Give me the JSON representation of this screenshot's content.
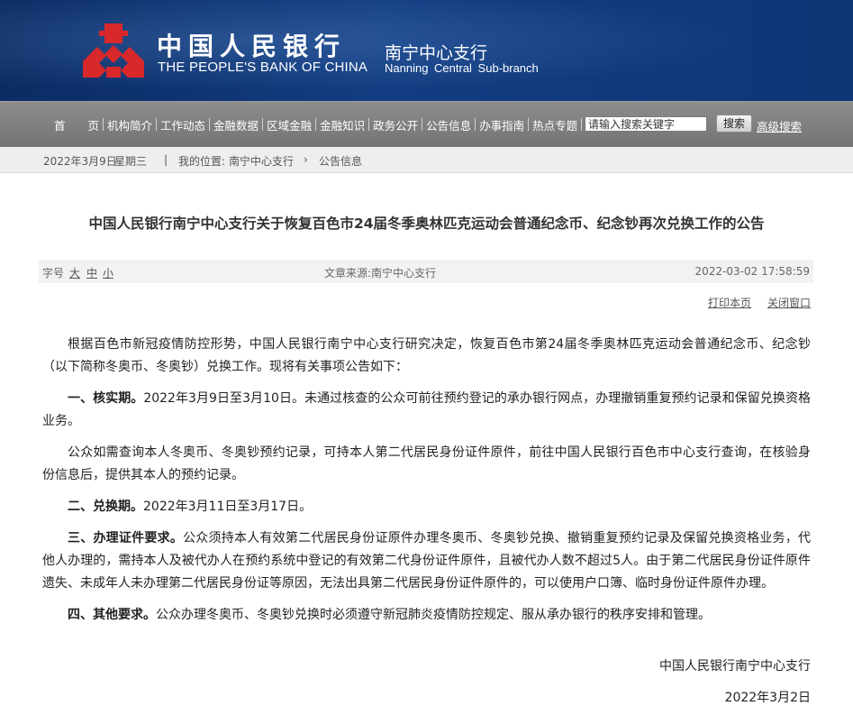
{
  "header": {
    "logo_cn": "中国人民银行",
    "logo_en": "THE PEOPLE'S BANK OF CHINA",
    "branch_cn": "南宁中心支行",
    "branch_en": "Nanning Central Sub-branch"
  },
  "nav": {
    "items": [
      "首　　页",
      "机构简介",
      "工作动态",
      "金融数据",
      "区域金融",
      "金融知识",
      "政务公开",
      "公告信息",
      "办事指南",
      "热点专题"
    ],
    "search_placeholder": "请输入搜索关键字",
    "search_button": "搜索",
    "advanced_search": "高级搜索"
  },
  "breadcrumb": {
    "date": "2022年3月9日",
    "weekday": "星期三",
    "location_label": "我的位置:",
    "path": [
      "南宁中心支行",
      "公告信息"
    ]
  },
  "article": {
    "title": "中国人民银行南宁中心支行关于恢复百色市24届冬季奥林匹克运动会普通纪念币、纪念钞再次兑换工作的公告",
    "font_label": "字号",
    "font_large": "大",
    "font_medium": "中",
    "font_small": "小",
    "source": "文章来源:南宁中心支行",
    "datetime": "2022-03-02  17:58:59",
    "print": "打印本页",
    "close": "关闭窗口",
    "paragraphs": [
      {
        "lead": "",
        "text": "根据百色市新冠疫情防控形势，中国人民银行南宁中心支行研究决定，恢复百色市第24届冬季奥林匹克运动会普通纪念币、纪念钞（以下简称冬奥币、冬奥钞）兑换工作。现将有关事项公告如下："
      },
      {
        "lead": "一、核实期。",
        "text": "2022年3月9日至3月10日。未通过核查的公众可前往预约登记的承办银行网点，办理撤销重复预约记录和保留兑换资格业务。"
      },
      {
        "lead": "",
        "text": "公众如需查询本人冬奥币、冬奥钞预约记录，可持本人第二代居民身份证件原件，前往中国人民银行百色市中心支行查询，在核验身份信息后，提供其本人的预约记录。"
      },
      {
        "lead": "二、兑换期。",
        "text": "2022年3月11日至3月17日。"
      },
      {
        "lead": "三、办理证件要求。",
        "text": "公众须持本人有效第二代居民身份证原件办理冬奥币、冬奥钞兑换、撤销重复预约记录及保留兑换资格业务，代他人办理的，需持本人及被代办人在预约系统中登记的有效第二代身份证件原件，且被代办人数不超过5人。由于第二代居民身份证件原件遗失、未成年人未办理第二代居民身份证等原因，无法出具第二代居民身份证件原件的，可以使用户口簿、临时身份证件原件办理。"
      },
      {
        "lead": "四、其他要求。",
        "text": "公众办理冬奥币、冬奥钞兑换时必须遵守新冠肺炎疫情防控规定、服从承办银行的秩序安排和管理。"
      }
    ],
    "signature": "中国人民银行南宁中心支行",
    "sign_date": "2022年3月2日"
  },
  "colors": {
    "header_bg": "#0e3576",
    "logo_red": "#d8282a",
    "nav_bg": "#7e7e7e",
    "breadcrumb_bg": "#eeeeee"
  }
}
